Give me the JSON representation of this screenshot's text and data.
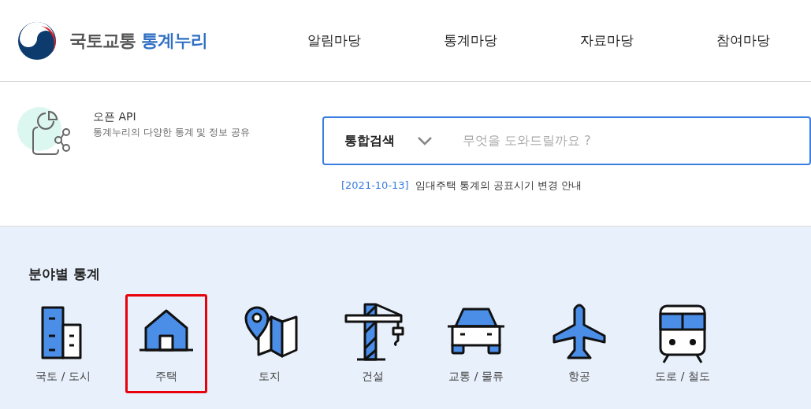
{
  "header": {
    "logo": {
      "prefix": "국토교통",
      "name": "통계누리"
    },
    "nav": [
      {
        "label": "알림마당"
      },
      {
        "label": "통계마당"
      },
      {
        "label": "자료마당"
      },
      {
        "label": "참여마당"
      }
    ]
  },
  "open_api": {
    "title": "오픈 API",
    "description": "통계누리의 다양한 통계 및 정보 공유"
  },
  "search": {
    "scope": "통합검색",
    "placeholder": "무엇을 도와드릴까요 ?"
  },
  "notice": {
    "date": "[2021-10-13]",
    "text": "임대주택 통계의 공표시기 변경 안내"
  },
  "categories_section": {
    "title": "분야별 통계",
    "items": [
      {
        "kind": "building",
        "label": "국토 / 도시",
        "highlighted": false
      },
      {
        "kind": "house",
        "label": "주택",
        "highlighted": true
      },
      {
        "kind": "map",
        "label": "토지",
        "highlighted": false
      },
      {
        "kind": "crane",
        "label": "건설",
        "highlighted": false
      },
      {
        "kind": "car",
        "label": "교통 / 물류",
        "highlighted": false
      },
      {
        "kind": "plane",
        "label": "항공",
        "highlighted": false
      },
      {
        "kind": "train",
        "label": "도로 / 철도",
        "highlighted": false
      }
    ]
  }
}
